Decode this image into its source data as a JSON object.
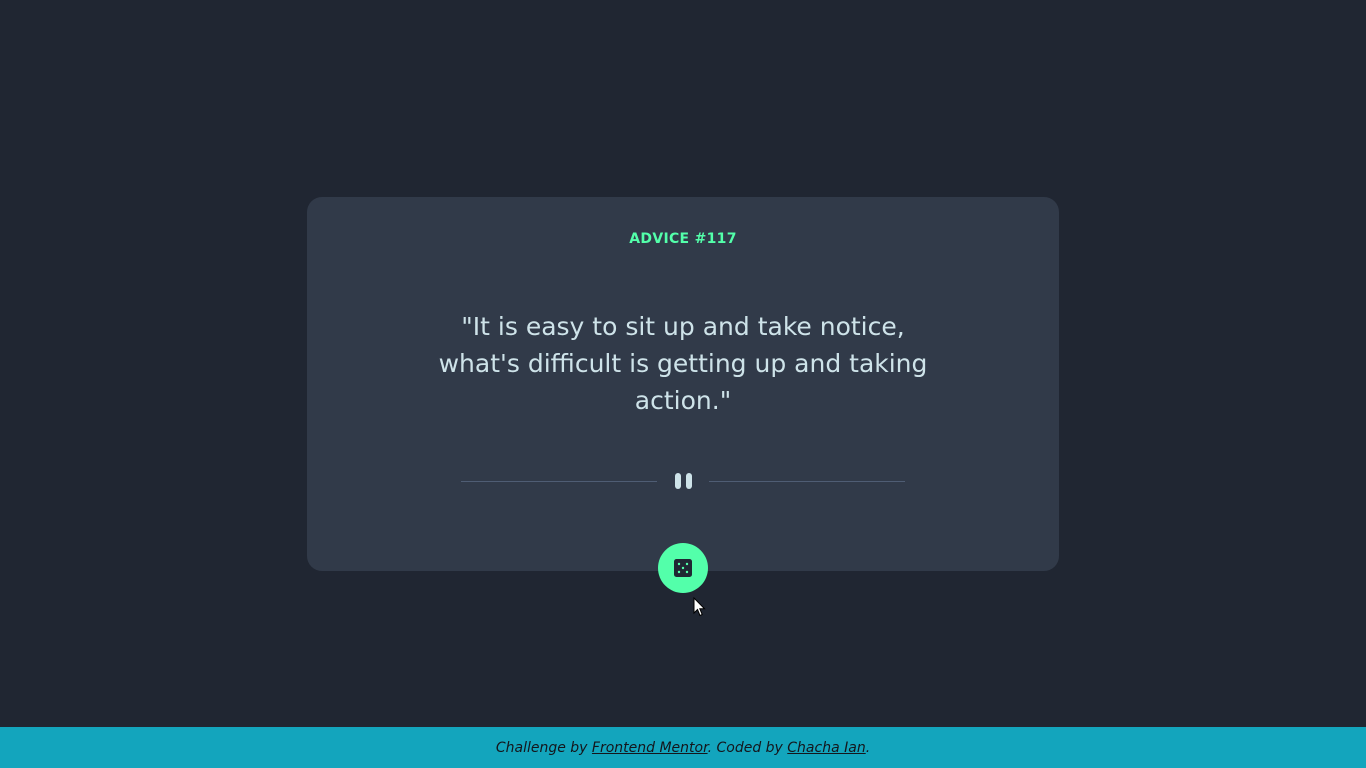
{
  "advice": {
    "label": "ADVICE #117",
    "quote": "\"It is easy to sit up and take notice, what's difficult is getting up and taking action.\""
  },
  "divider": {
    "icon": "pause-icon"
  },
  "button": {
    "icon": "dice-icon"
  },
  "footer": {
    "prefix": "Challenge by ",
    "link1": "Frontend Mentor",
    "middle": ". Coded by ",
    "link2": "Chacha Ian",
    "suffix": "."
  },
  "colors": {
    "background": "#202632",
    "card": "#313a49",
    "accent": "#53ffaa",
    "text": "#cee3e9",
    "divider": "#4f5d74",
    "footer": "#13a5bd"
  }
}
